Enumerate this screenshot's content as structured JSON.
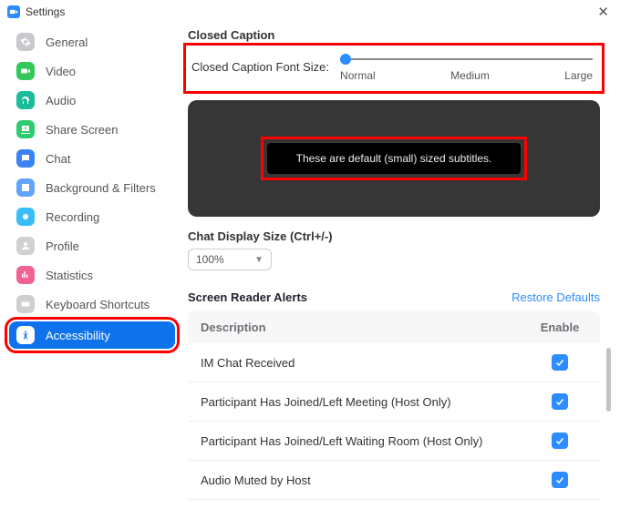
{
  "titlebar": {
    "title": "Settings"
  },
  "sidebar": {
    "items": [
      {
        "label": "General"
      },
      {
        "label": "Video"
      },
      {
        "label": "Audio"
      },
      {
        "label": "Share Screen"
      },
      {
        "label": "Chat"
      },
      {
        "label": "Background & Filters"
      },
      {
        "label": "Recording"
      },
      {
        "label": "Profile"
      },
      {
        "label": "Statistics"
      },
      {
        "label": "Keyboard Shortcuts"
      },
      {
        "label": "Accessibility"
      }
    ]
  },
  "cc": {
    "title": "Closed Caption",
    "slider_label": "Closed Caption Font Size:",
    "ticks": {
      "t0": "Normal",
      "t1": "Medium",
      "t2": "Large"
    },
    "preview_text": "These are default (small) sized subtitles."
  },
  "chatsize": {
    "title": "Chat Display Size (Ctrl+/-)",
    "value": "100%"
  },
  "sr": {
    "title": "Screen Reader Alerts",
    "restore": "Restore Defaults",
    "col_desc": "Description",
    "col_en": "Enable",
    "rows": [
      {
        "label": "IM Chat Received"
      },
      {
        "label": "Participant Has Joined/Left Meeting (Host Only)"
      },
      {
        "label": "Participant Has Joined/Left Waiting Room (Host Only)"
      },
      {
        "label": "Audio Muted by Host"
      }
    ]
  }
}
